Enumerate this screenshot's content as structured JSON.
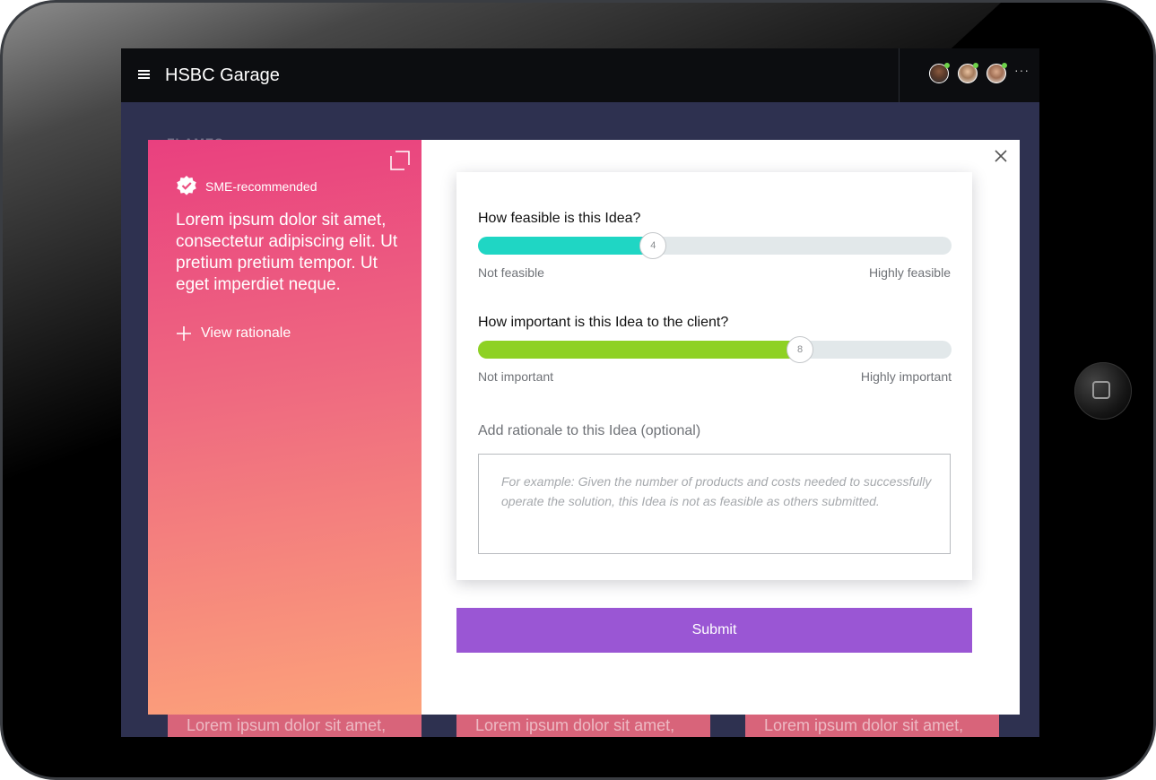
{
  "app": {
    "title": "HSBC Garage",
    "section_label": "FLAMES"
  },
  "header": {
    "avatars": [
      "user-avatar-1",
      "user-avatar-2",
      "user-avatar-3"
    ],
    "more_label": "···"
  },
  "background_cards": [
    {
      "text": "Lorem ipsum dolor sit amet, consectetur adipiscing elit."
    },
    {
      "text": "Lorem ipsum dolor sit amet, consectetur adipiscing elit."
    },
    {
      "text": "Lorem ipsum dolor sit amet, consectetur adipiscing elit."
    }
  ],
  "idea": {
    "badge": "SME-recommended",
    "text": "Lorem ipsum dolor sit amet, consectetur adipiscing elit. Ut pretium pretium tempor. Ut eget imperdiet neque.",
    "view_rationale": "View rationale"
  },
  "rating": {
    "feasibility": {
      "question": "How feasible is this Idea?",
      "value": "4",
      "level": 0.37,
      "min_label": "Not feasible",
      "max_label": "Highly feasible",
      "color": "#1fd6c4"
    },
    "importance": {
      "question": "How important is this Idea to the client?",
      "value": "8",
      "level": 0.68,
      "min_label": "Not important",
      "max_label": "Highly important",
      "color": "#8ed124"
    },
    "rationale_label": "Add rationale to this Idea (optional)",
    "rationale_placeholder": "For example: Given the number of products and costs needed to successfully operate the solution, this Idea is not as feasible as others submitted.",
    "submit_label": "Submit"
  },
  "colors": {
    "accent": "#9a56d4",
    "topbar": "#0c0d10",
    "canvas": "#2e3150",
    "gradient_top": "#e9407f",
    "gradient_bottom": "#fca27a"
  }
}
